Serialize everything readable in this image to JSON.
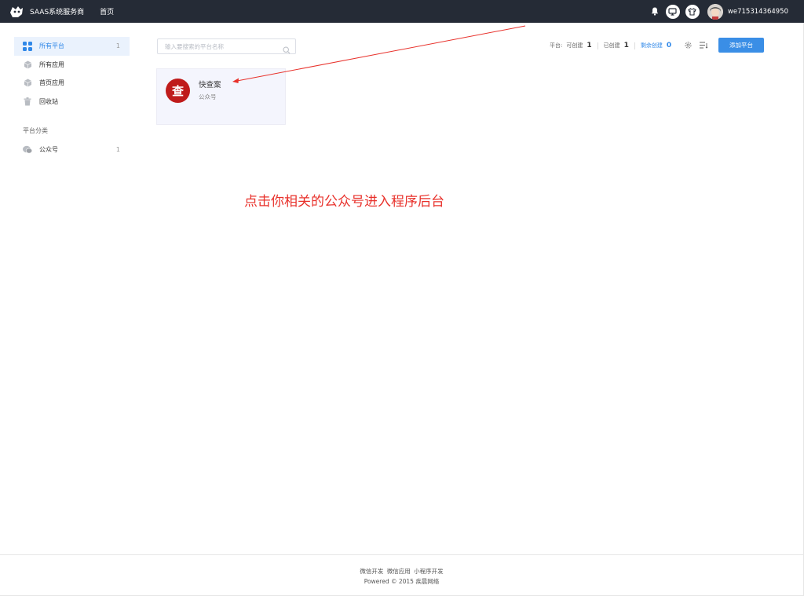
{
  "topbar": {
    "brand": "SAAS系统服务商",
    "home_label": "首页",
    "username": "we715314364950"
  },
  "sidebar": {
    "items": [
      {
        "label": "所有平台",
        "count": "1",
        "icon": "grid-icon"
      },
      {
        "label": "所有应用",
        "icon": "cube-icon"
      },
      {
        "label": "首页应用",
        "icon": "cube-icon"
      },
      {
        "label": "回收站",
        "icon": "trash-icon"
      }
    ],
    "section_title": "平台分类",
    "categories": [
      {
        "label": "公众号",
        "count": "1",
        "icon": "wechat-icon"
      }
    ]
  },
  "search": {
    "placeholder": "输入要搜索的平台名称"
  },
  "stats": {
    "platform_label": "平台:",
    "can_create_label": "可创建",
    "can_create_value": "1",
    "created_label": "已创建",
    "created_value": "1",
    "remaining_label": "剩余创建",
    "remaining_value": "0"
  },
  "add_button_label": "添加平台",
  "card": {
    "logo_char": "查",
    "title": "快查案",
    "type": "公众号"
  },
  "annotation": "点击你相关的公众号进入程序后台",
  "footer": {
    "links": [
      "微信开发",
      "微信应用",
      "小程序开发"
    ],
    "powered": "Powered © 2015 疾晨网络"
  },
  "colors": {
    "topbar_bg": "#252b36",
    "accent": "#3a8ee6",
    "annotation": "#e8312b",
    "card_logo": "#bf1b1b"
  }
}
